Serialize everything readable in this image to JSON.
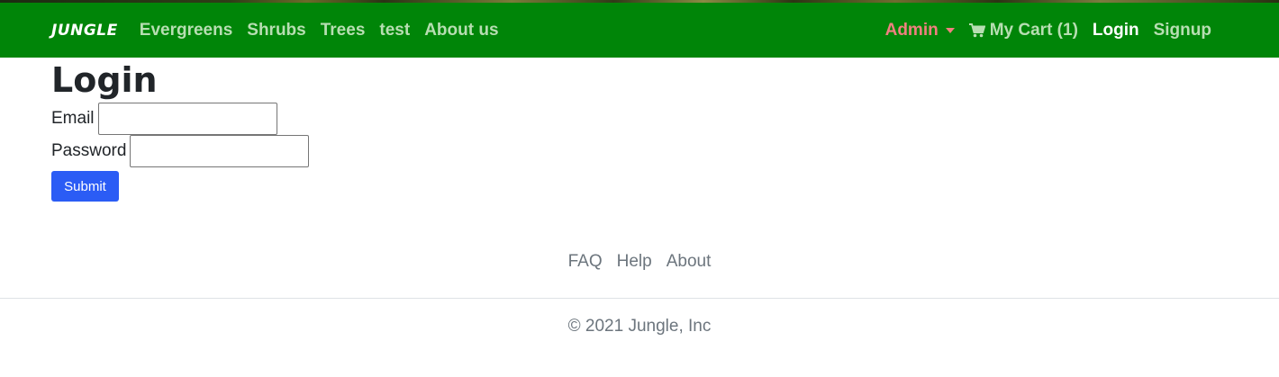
{
  "navbar": {
    "brand": "JUNGLE",
    "links": [
      "Evergreens",
      "Shrubs",
      "Trees",
      "test",
      "About us"
    ],
    "admin": "Admin",
    "cart": "My Cart (1)",
    "login": "Login",
    "signup": "Signup"
  },
  "page": {
    "title": "Login",
    "email_label": "Email",
    "password_label": "Password",
    "submit_label": "Submit"
  },
  "footer": {
    "links": [
      "FAQ",
      "Help",
      "About"
    ],
    "copyright": "© 2021 Jungle, Inc"
  },
  "colors": {
    "navbar": "#008508",
    "admin": "#f08080",
    "submit": "#2b5cf5"
  }
}
